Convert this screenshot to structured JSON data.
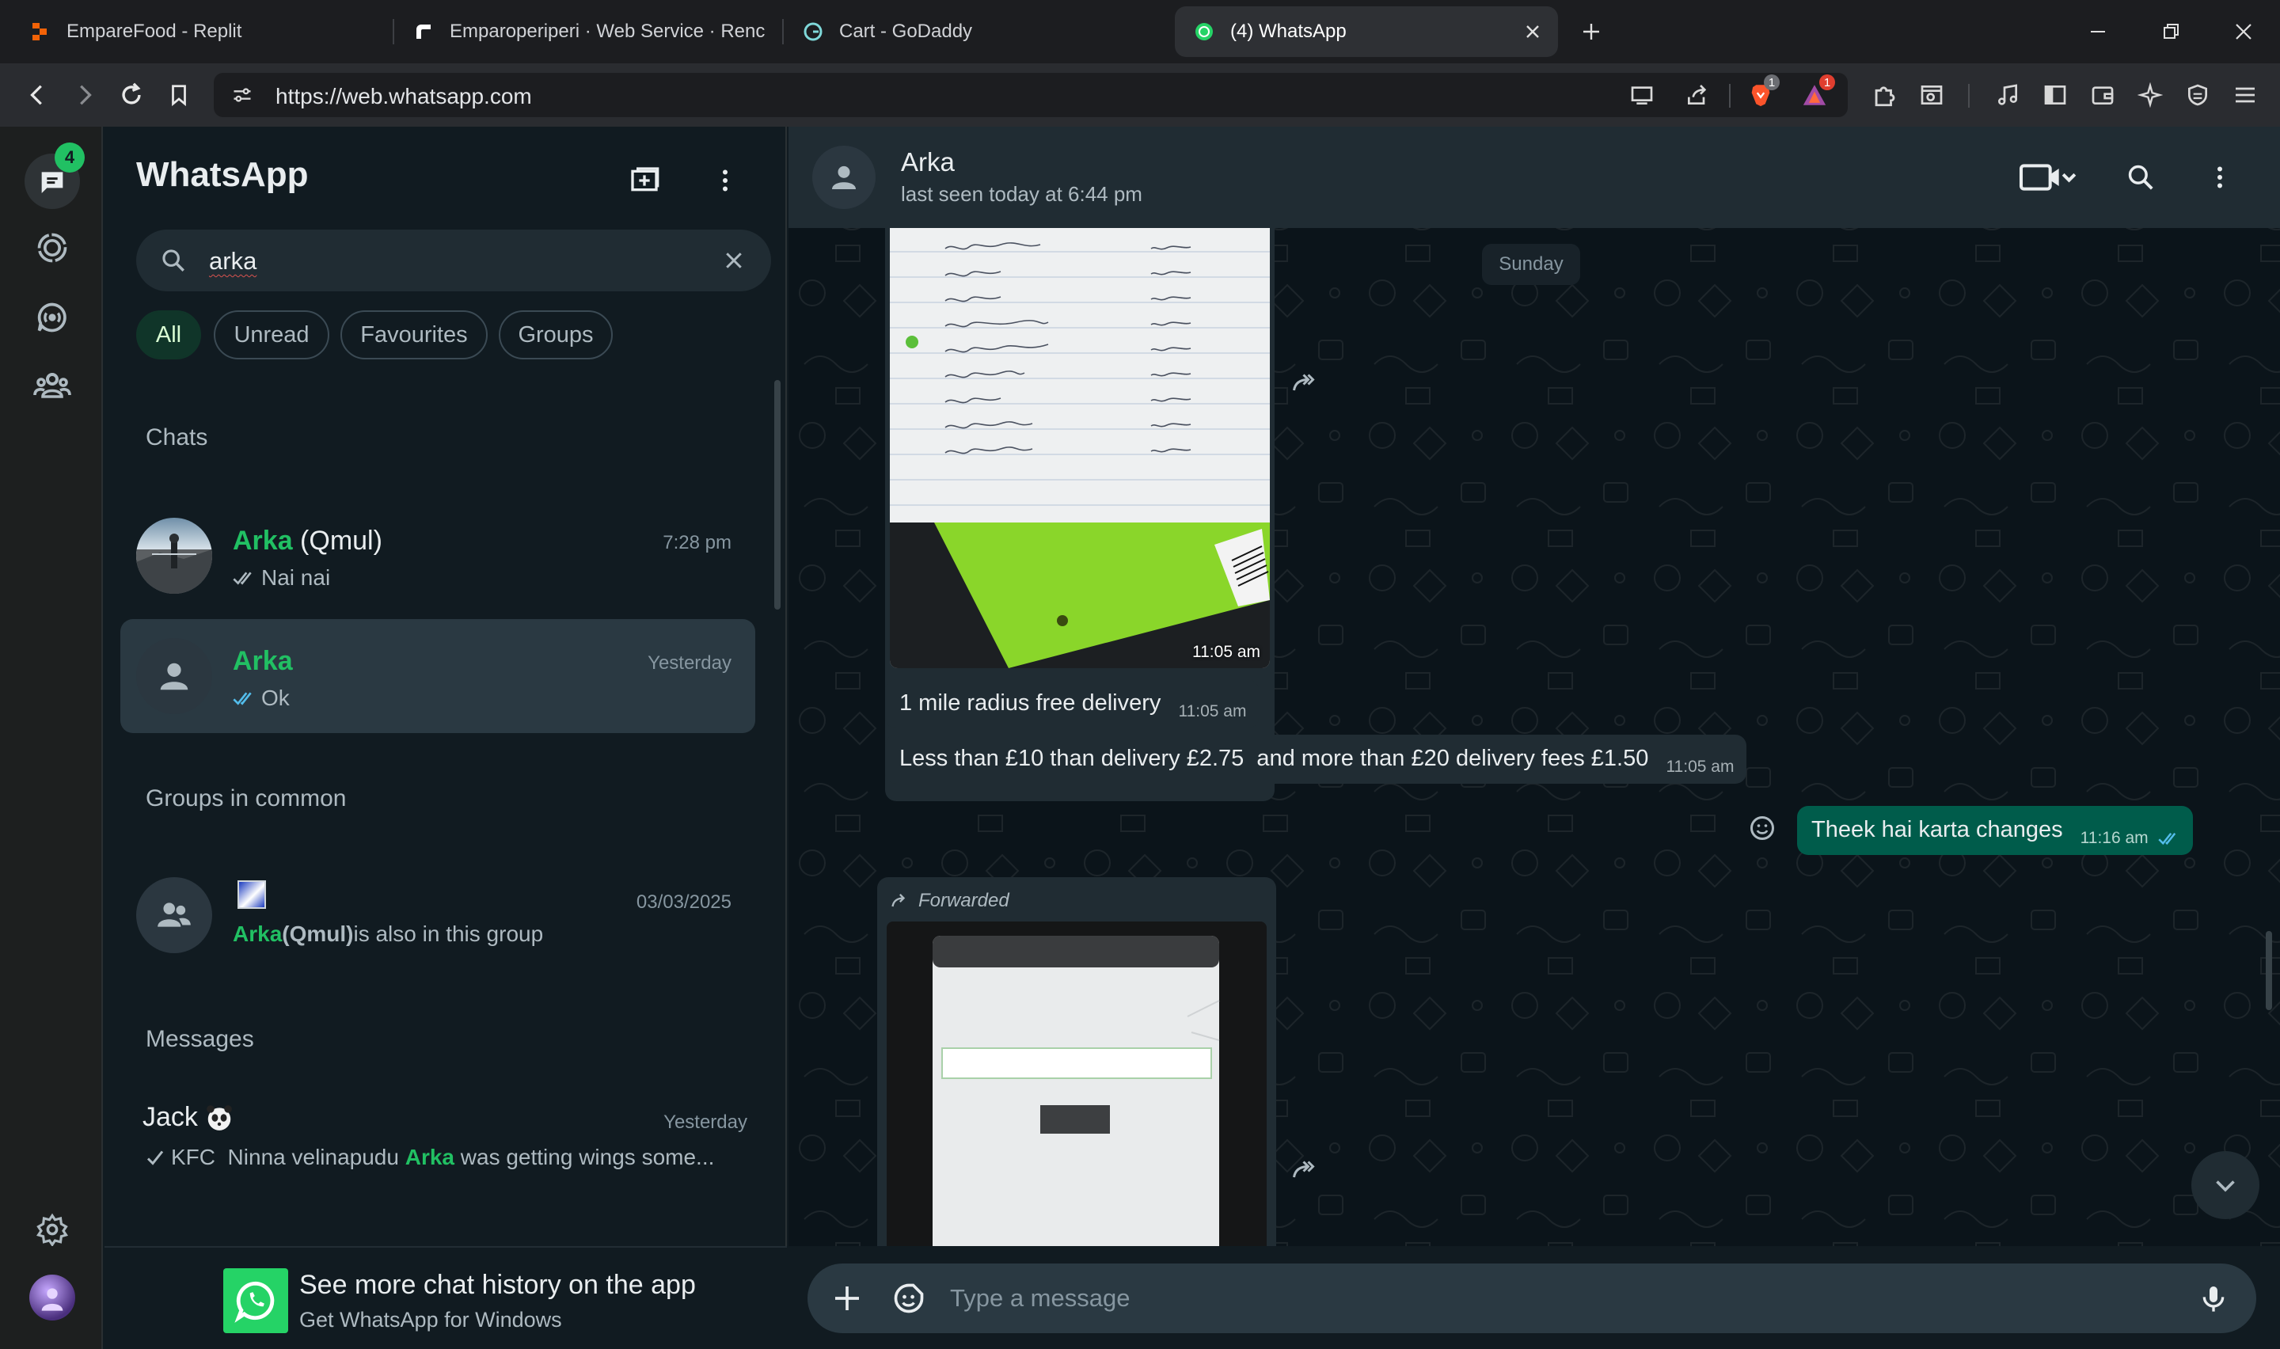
{
  "browser": {
    "tabs": [
      {
        "title": "EmpareFood - Replit"
      },
      {
        "title": "Emparoperiperi · Web Service · Renc"
      },
      {
        "title": "Cart - GoDaddy"
      },
      {
        "title": "(4) WhatsApp"
      }
    ],
    "url": "https://web.whatsapp.com",
    "brave_badge": "1",
    "rewards_badge": "1"
  },
  "rail": {
    "chats_badge": "4"
  },
  "sidebar": {
    "title": "WhatsApp",
    "search_value": "arka",
    "filters": [
      "All",
      "Unread",
      "Favourites",
      "Groups"
    ],
    "chats_heading": "Chats",
    "chats": [
      {
        "name_match": "Arka",
        "name_rest": " (Qmul)",
        "time": "7:28 pm",
        "preview": "Nai nai"
      },
      {
        "name_match": "Arka",
        "name_rest": "",
        "time": "Yesterday",
        "preview": "Ok"
      }
    ],
    "groups_heading": "Groups in common",
    "group": {
      "time": "03/03/2025",
      "match": "Arka",
      "match_rest": " (Qmul)",
      "tail": " is also in this group"
    },
    "messages_heading": "Messages",
    "message": {
      "name": "Jack",
      "time": "Yesterday",
      "pre": "KFC  Ninna velinapudu ",
      "match": "Arka",
      "post": " was getting wings some..."
    },
    "promo_title": "See more chat history on the app",
    "promo_sub": "Get WhatsApp for Windows"
  },
  "chat": {
    "contact": "Arka",
    "status": "last seen today at 6:44 pm",
    "day_label": "Sunday",
    "image1_time": "11:05 am",
    "msg1": {
      "text": "1 mile radius free delivery",
      "time": "11:05 am"
    },
    "msg2": {
      "text": "Less than £10 than delivery £2.75  and more than £20 delivery fees £1.50",
      "time": "11:05 am"
    },
    "msg3": {
      "text": "Theek hai karta changes",
      "time": "11:16 am"
    },
    "forwarded_label": "Forwarded",
    "composer_placeholder": "Type a message"
  },
  "colors": {
    "accent": "#21c063",
    "outgoing": "#005c4b",
    "incoming": "#202c33",
    "panel": "#111b21"
  }
}
